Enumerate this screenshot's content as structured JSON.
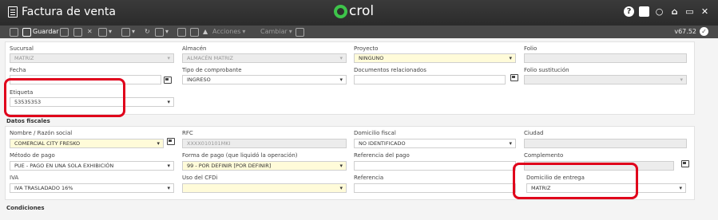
{
  "window": {
    "title": "Factura de venta",
    "logo_text": "crol"
  },
  "window_icons": [
    "help-icon",
    "record-icon",
    "chat-icon",
    "home-icon",
    "minimize-icon",
    "close-icon"
  ],
  "toolbar": {
    "save_label": "Guardar",
    "actions_label": "Acciones",
    "change_label": "Cambiar",
    "version": "v67.52"
  },
  "general": {
    "sucursal": {
      "label": "Sucursal",
      "value": "MATRIZ"
    },
    "almacen": {
      "label": "Almacén",
      "value": "ALMACÉN MATRIZ"
    },
    "proyecto": {
      "label": "Proyecto",
      "value": "NINGUNO"
    },
    "folio": {
      "label": "Folio",
      "value": ""
    },
    "fecha": {
      "label": "Fecha",
      "value": ""
    },
    "tipo_comprobante": {
      "label": "Tipo de comprobante",
      "value": "INGRESO"
    },
    "documentos": {
      "label": "Documentos relacionados",
      "value": ""
    },
    "folio_sustitucion": {
      "label": "Folio sustitución",
      "value": ""
    },
    "etiqueta": {
      "label": "Etiqueta",
      "value": "53535353"
    }
  },
  "fiscal": {
    "section_title": "Datos fiscales",
    "nombre": {
      "label": "Nombre / Razón social",
      "value": "COMERCIAL CITY FRESKO"
    },
    "rfc": {
      "label": "RFC",
      "value": "XXXX010101MKI"
    },
    "domicilio_fiscal": {
      "label": "Domicilio fiscal",
      "value": "NO IDENTIFICADO"
    },
    "ciudad": {
      "label": "Ciudad",
      "value": ""
    },
    "metodo_pago": {
      "label": "Método de pago",
      "value": "PUE - PAGO EN UNA SOLA EXHIBICIÓN"
    },
    "forma_pago": {
      "label": "Forma de pago (que liquidó la operación)",
      "value": "99 - POR DEFINIR [POR DEFINIR]"
    },
    "referencia_pago": {
      "label": "Referencia del pago",
      "value": ""
    },
    "complemento": {
      "label": "Complemento",
      "value": ""
    },
    "iva": {
      "label": "IVA",
      "value": "IVA TRASLADADO 16%"
    },
    "uso_cfdi": {
      "label": "Uso del CFDi",
      "value": ""
    },
    "referencia": {
      "label": "Referencia",
      "value": ""
    },
    "domicilio_entrega": {
      "label": "Domicilio de entrega",
      "value": "MATRIZ"
    }
  },
  "conditions": {
    "section_title": "Condiciones"
  },
  "highlight_color": "#e0001b"
}
